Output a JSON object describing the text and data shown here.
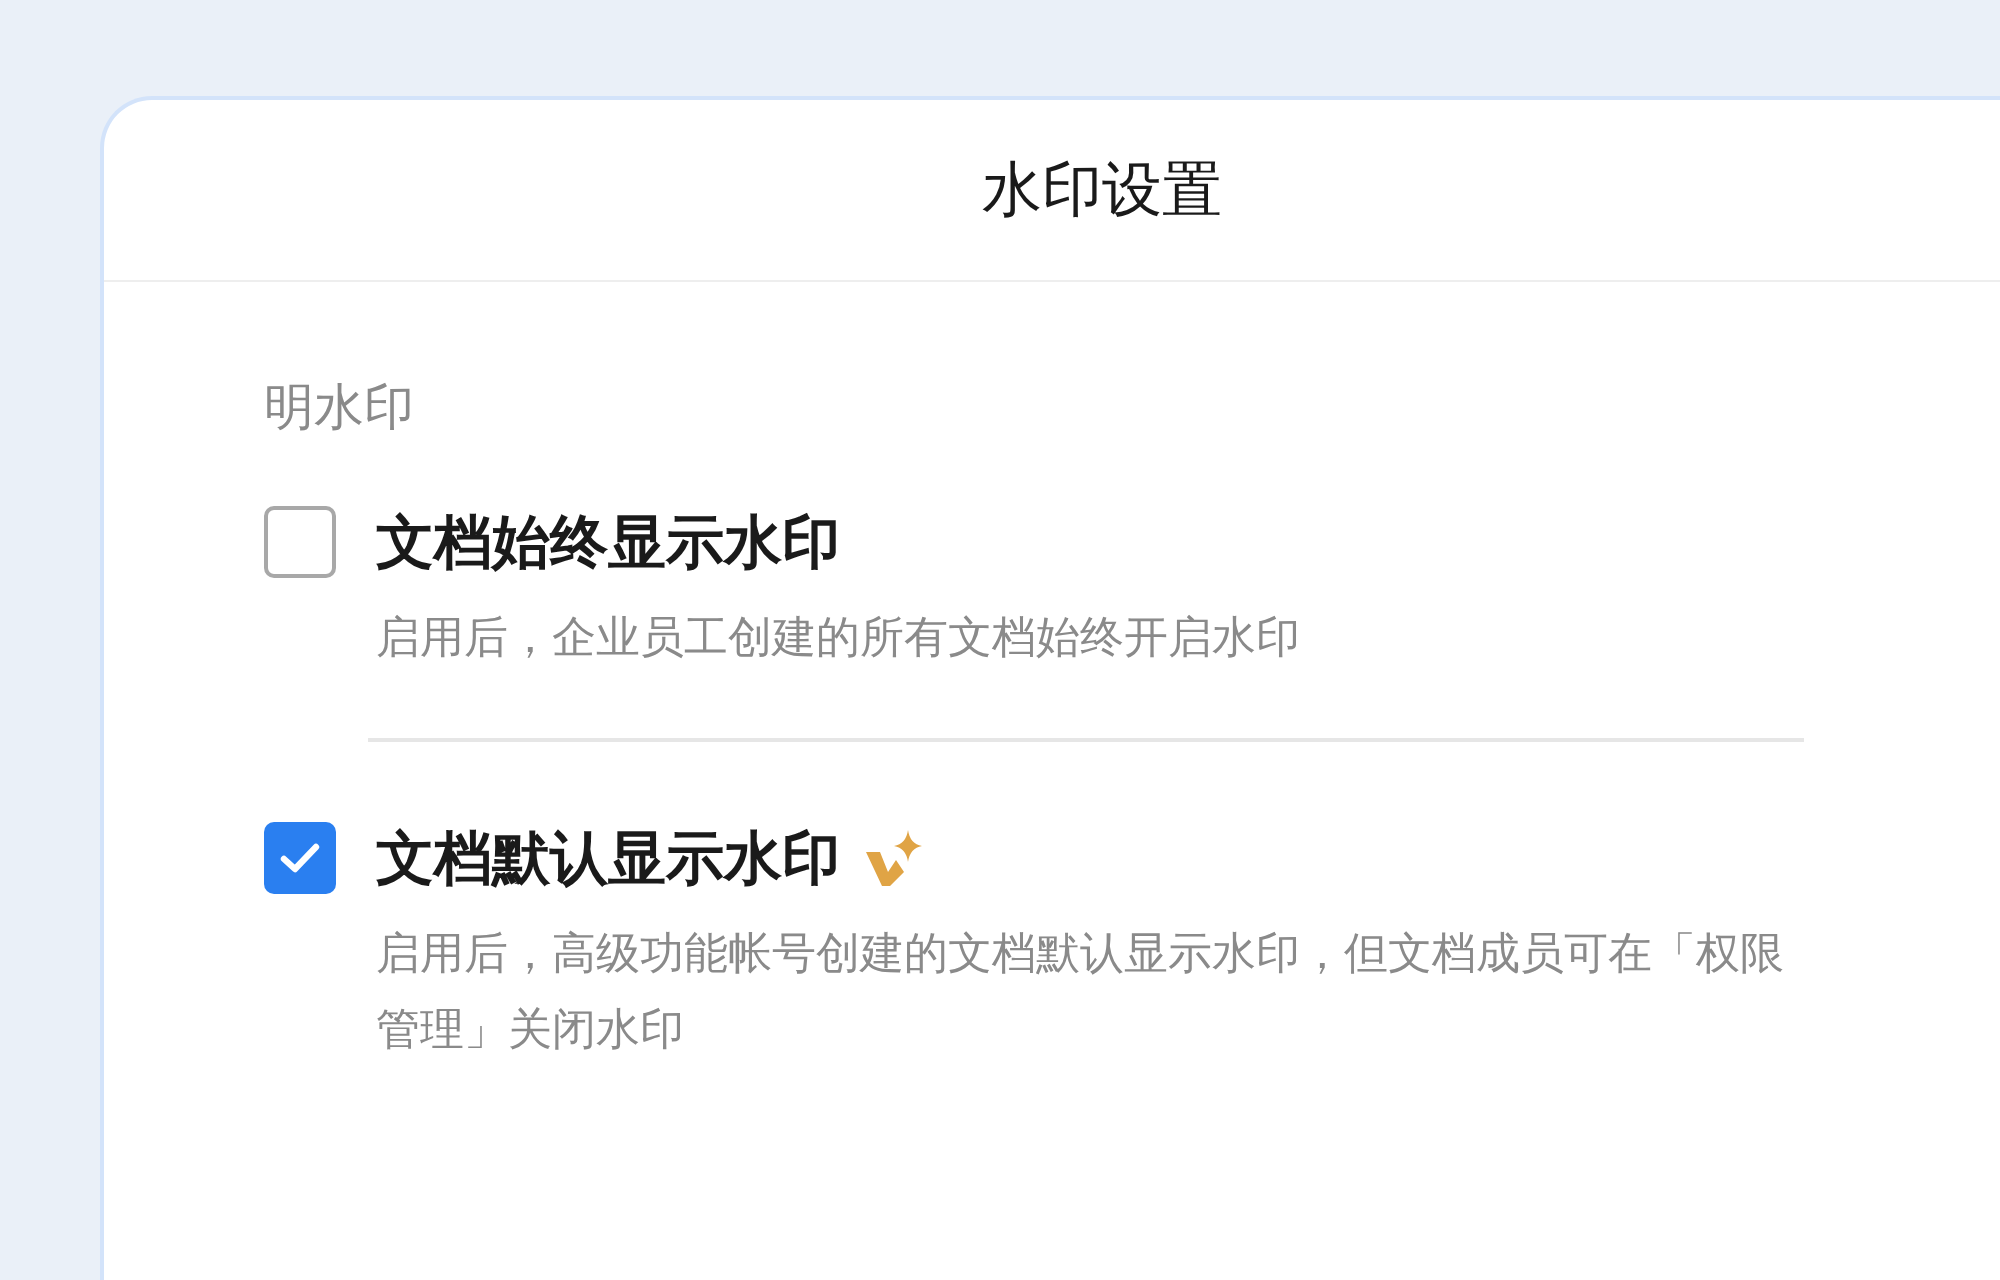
{
  "dialog": {
    "title": "水印设置"
  },
  "section": {
    "label": "明水印"
  },
  "options": [
    {
      "label": "文档始终显示水印",
      "checked": false,
      "premium": false,
      "description": "启用后，企业员工创建的所有文档始终开启水印"
    },
    {
      "label": "文档默认显示水印",
      "checked": true,
      "premium": true,
      "description": "启用后，高级功能帐号创建的文档默认显示水印，但文档成员可在「权限管理」关闭水印"
    }
  ]
}
